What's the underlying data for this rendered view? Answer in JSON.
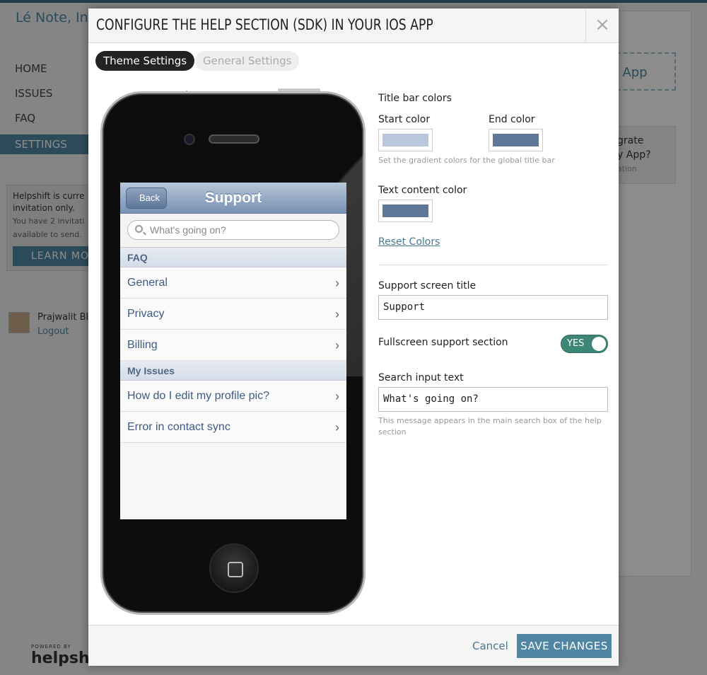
{
  "background": {
    "brand": "Lé Note, Inc",
    "nav": [
      "HOME",
      "ISSUES",
      "FAQ",
      "SETTINGS"
    ],
    "invite_line1": "Helpshift is curre",
    "invite_line2": "invitation only.",
    "invite_line3": "You have 2 invitati",
    "invite_line4": "available to send.",
    "learn_more": "LEARN MO",
    "user_name": "Prajwalit Bl",
    "logout": "Logout",
    "new_app": "v App",
    "integrate_line1": "grate",
    "integrate_line2": "y App?",
    "integrate_sub": "ation",
    "powered_by": "POWERED BY",
    "logo_text": "helpsh"
  },
  "modal": {
    "title": "CONFIGURE THE HELP SECTION (SDK) IN YOUR IOS APP",
    "close_symbol": "×",
    "tabs": [
      "Theme Settings",
      "General Settings"
    ]
  },
  "phone": {
    "back_label": "Back",
    "nav_title": "Support",
    "search_placeholder": "What's going on?",
    "sections": [
      {
        "title": "FAQ",
        "rows": [
          "General",
          "Privacy",
          "Billing"
        ]
      },
      {
        "title": "My Issues",
        "rows": [
          "How do I edit my profile pic?",
          "Error in contact sync"
        ]
      }
    ],
    "chevron": "›"
  },
  "settings": {
    "title_bar_colors": "Title bar colors",
    "start_color_label": "Start color",
    "end_color_label": "End color",
    "start_color": "#b8c7da",
    "end_color": "#5f7798",
    "gradient_hint": "Set the gradient colors for the global title bar",
    "text_color_label": "Text content color",
    "text_color": "#5f7798",
    "reset": "Reset Colors",
    "screen_title_label": "Support screen title",
    "screen_title_value": "Support",
    "fullscreen_label": "Fullscreen support section",
    "fullscreen_value": "YES",
    "search_label": "Search input text",
    "search_value": "What's going on?",
    "search_hint": "This message appears in the main search box of the help section"
  },
  "footer": {
    "cancel": "Cancel",
    "save": "SAVE CHANGES"
  }
}
